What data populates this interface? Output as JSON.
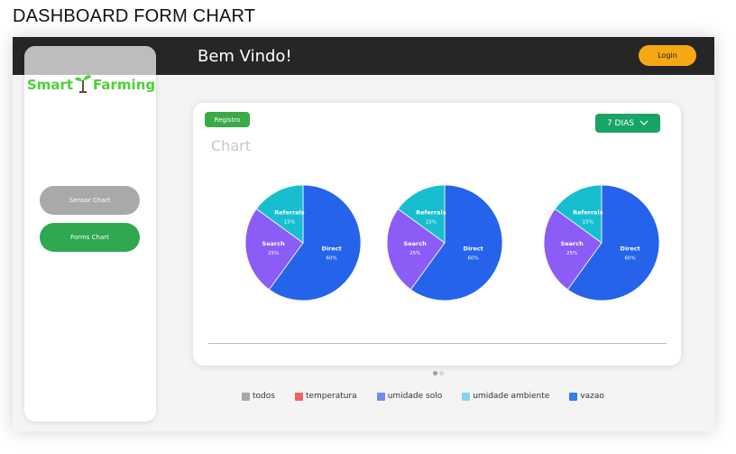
{
  "page_heading": "DASHBOARD FORM CHART",
  "header": {
    "welcome": "Bem Vindo!",
    "login_label": "Login"
  },
  "sidebar": {
    "logo_left": "Smart",
    "logo_right": "Farming",
    "buttons": [
      {
        "label": "Sensor Chart"
      },
      {
        "label": "Forms Chart"
      }
    ]
  },
  "card": {
    "registro_label": "Registro",
    "range_select": "7 DIAS",
    "chart_title": "Chart"
  },
  "chart_data": [
    {
      "type": "pie",
      "slices": [
        {
          "name": "Direct",
          "value": 60,
          "label": "60%",
          "color": "#2563eb"
        },
        {
          "name": "Search",
          "value": 25,
          "label": "25%",
          "color": "#8b5cf6"
        },
        {
          "name": "Referrals",
          "value": 15,
          "label": "15%",
          "color": "#17becf"
        }
      ]
    },
    {
      "type": "pie",
      "slices": [
        {
          "name": "Direct",
          "value": 60,
          "label": "60%",
          "color": "#2563eb"
        },
        {
          "name": "Search",
          "value": 25,
          "label": "25%",
          "color": "#8b5cf6"
        },
        {
          "name": "Referrals",
          "value": 15,
          "label": "15%",
          "color": "#17becf"
        }
      ]
    },
    {
      "type": "pie",
      "slices": [
        {
          "name": "Direct",
          "value": 60,
          "label": "60%",
          "color": "#2563eb"
        },
        {
          "name": "Search",
          "value": 25,
          "label": "25%",
          "color": "#8b5cf6"
        },
        {
          "name": "Referrals",
          "value": 15,
          "label": "15%",
          "color": "#17becf"
        }
      ]
    }
  ],
  "pagination": {
    "active_color": "#9e9e9e",
    "inactive_color": "#d6d6d6"
  },
  "legend": [
    {
      "label": "todos",
      "color": "#a8a8a8"
    },
    {
      "label": "temperatura",
      "color": "#f06262"
    },
    {
      "label": "umidade solo",
      "color": "#6b8cf0"
    },
    {
      "label": "umidade ambiente",
      "color": "#7fd8ee"
    },
    {
      "label": "vazao",
      "color": "#2f80ed"
    }
  ],
  "colors": {
    "accent_green": "#2fa84f",
    "login": "#f6a813",
    "topbar": "#262626"
  }
}
